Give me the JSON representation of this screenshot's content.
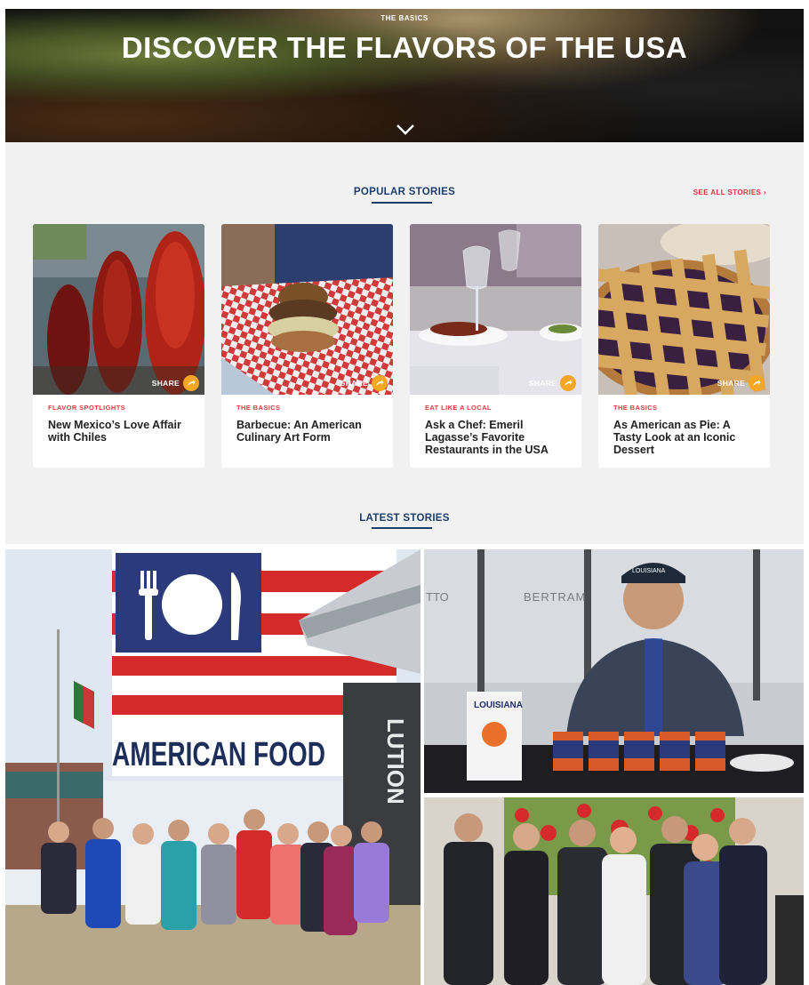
{
  "hero": {
    "eyebrow": "THE BASICS",
    "title": "DISCOVER THE FLAVORS OF THE USA",
    "scroll_icon": "chevron-down-icon"
  },
  "popular": {
    "heading": "POPULAR STORIES",
    "see_all": "SEE ALL STORIES",
    "see_all_icon": "chevron-right-icon",
    "share_label": "SHARE",
    "share_icon": "share-arrow-icon",
    "accent_color": "#e03a3e",
    "share_color": "#f5a623",
    "cards": [
      {
        "category": "FLAVOR SPOTLIGHTS",
        "title": "New Mexico’s Love Affair with Chiles"
      },
      {
        "category": "THE BASICS",
        "title": "Barbecue: An American Culinary Art Form"
      },
      {
        "category": "EAT LIKE A LOCAL",
        "title": "Ask a Chef: Emeril Lagasse’s Favorite Restaurants in the USA"
      },
      {
        "category": "THE BASICS",
        "title": "As American as Pie: A Tasty Look at an Iconic Dessert"
      }
    ]
  },
  "latest": {
    "heading": "LATEST STORIES",
    "photos": {
      "pavilion_sign": "AMERICAN FOOD",
      "pavilion_side": "LUTION",
      "bar_sign_1": "BERTRAM",
      "bar_sign_2": "TTO",
      "cap_text": "LOUISIANA",
      "poster_title": "LOUISIANA"
    }
  }
}
